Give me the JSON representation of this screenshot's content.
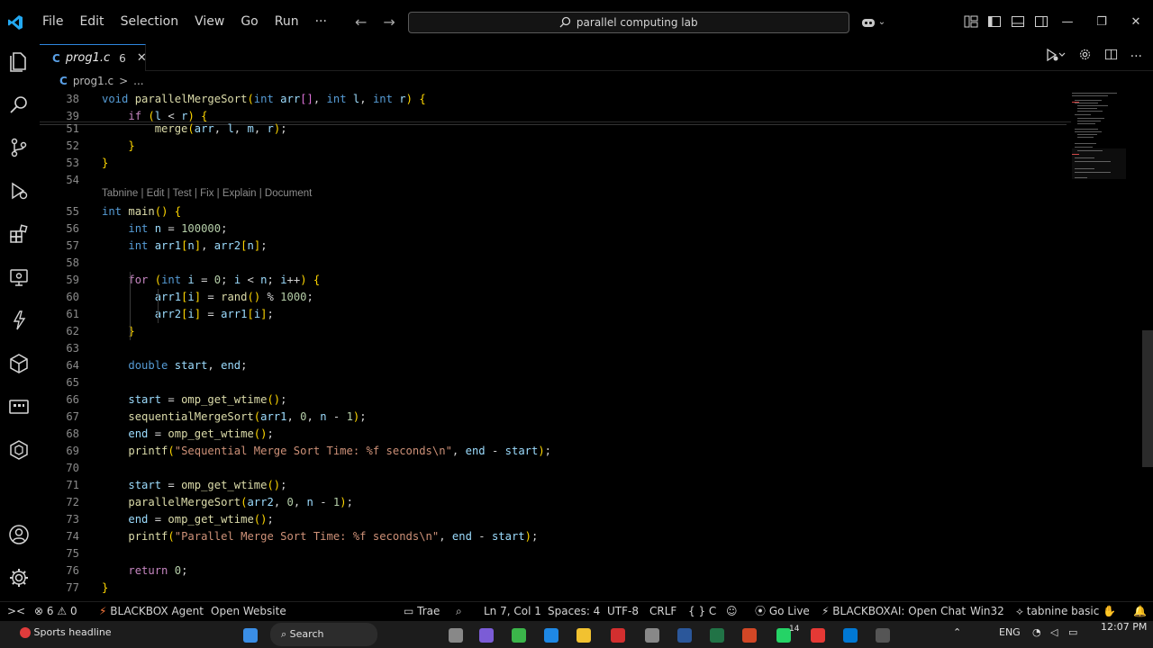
{
  "titlebar": {
    "menu": [
      "File",
      "Edit",
      "Selection",
      "View",
      "Go",
      "Run",
      "···"
    ],
    "search": "parallel computing lab"
  },
  "tab": {
    "lang_badge": "C",
    "filename": "prog1.c",
    "problems": "6",
    "close": "✕"
  },
  "breadcrumb": {
    "lang_badge": "C",
    "file": "prog1.c",
    "sep": ">",
    "rest": "..."
  },
  "codelens": "Tabnine | Edit | Test | Fix | Explain | Document",
  "code_lines": [
    {
      "n": "38",
      "t": "void parallelMergeSort(int arr[], int l, int r) {"
    },
    {
      "n": "39",
      "t": "    if (l < r) {"
    },
    {
      "n": "51",
      "t": "        merge(arr, l, m, r);"
    },
    {
      "n": "52",
      "t": "    }"
    },
    {
      "n": "53",
      "t": "}"
    },
    {
      "n": "54",
      "t": ""
    },
    {
      "n": "55",
      "t": "int main() {"
    },
    {
      "n": "56",
      "t": "    int n = 100000;"
    },
    {
      "n": "57",
      "t": "    int arr1[n], arr2[n];"
    },
    {
      "n": "58",
      "t": ""
    },
    {
      "n": "59",
      "t": "    for (int i = 0; i < n; i++) {"
    },
    {
      "n": "60",
      "t": "        arr1[i] = rand() % 1000;"
    },
    {
      "n": "61",
      "t": "        arr2[i] = arr1[i];"
    },
    {
      "n": "62",
      "t": "    }"
    },
    {
      "n": "63",
      "t": ""
    },
    {
      "n": "64",
      "t": "    double start, end;"
    },
    {
      "n": "65",
      "t": ""
    },
    {
      "n": "66",
      "t": "    start = omp_get_wtime();"
    },
    {
      "n": "67",
      "t": "    sequentialMergeSort(arr1, 0, n - 1);"
    },
    {
      "n": "68",
      "t": "    end = omp_get_wtime();"
    },
    {
      "n": "69",
      "t": "    printf(\"Sequential Merge Sort Time: %f seconds\\n\", end - start);"
    },
    {
      "n": "70",
      "t": ""
    },
    {
      "n": "71",
      "t": "    start = omp_get_wtime();"
    },
    {
      "n": "72",
      "t": "    parallelMergeSort(arr2, 0, n - 1);"
    },
    {
      "n": "73",
      "t": "    end = omp_get_wtime();"
    },
    {
      "n": "74",
      "t": "    printf(\"Parallel Merge Sort Time: %f seconds\\n\", end - start);"
    },
    {
      "n": "75",
      "t": ""
    },
    {
      "n": "76",
      "t": "    return 0;"
    },
    {
      "n": "77",
      "t": "}"
    }
  ],
  "statusbar": {
    "remote": "><",
    "errors": "6",
    "warnings": "0",
    "blackbox_agent": "BLACKBOX Agent",
    "open_website": "Open Website",
    "trae": "Trae",
    "position": "Ln 7, Col 1",
    "spaces": "Spaces: 4",
    "encoding": "UTF-8",
    "eol": "CRLF",
    "language": "C",
    "go_live": "Go Live",
    "blackboxai": "BLACKBOXAI: Open Chat",
    "platform": "Win32",
    "tabnine": "tabnine basic"
  },
  "taskbar": {
    "news": "Sports headline",
    "search": "Search",
    "lang": "ENG",
    "time": "12:07 PM",
    "badge": "14"
  },
  "colors": {
    "accent": "#2e86de",
    "error": "#f14c4c",
    "tabnine": "#ff6b3d"
  }
}
